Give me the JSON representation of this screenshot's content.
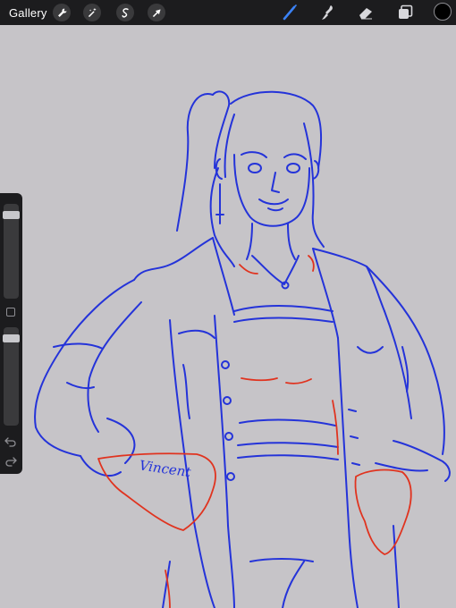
{
  "toolbar": {
    "gallery_label": "Gallery",
    "left_tools": [
      "wrench-icon",
      "magic-wand-icon",
      "selection-icon",
      "transform-arrow-icon"
    ],
    "right_tools": [
      "brush-icon",
      "smudge-icon",
      "eraser-icon",
      "layers-icon",
      "color-well"
    ],
    "active_tool": "brush-icon",
    "active_color": "#3b82f6",
    "current_color": "#000000"
  },
  "sidebar": {
    "brush_size_level": 0.06,
    "opacity_level": 0.03,
    "controls": [
      "brush-size-slider",
      "modify-button",
      "opacity-slider",
      "undo-icon",
      "redo-icon"
    ]
  },
  "canvas": {
    "background": "#c6c4c8",
    "signature_text": "Vincent",
    "stroke_colors": {
      "sketch": "#2433d9",
      "underlay": "#e0331f"
    }
  }
}
